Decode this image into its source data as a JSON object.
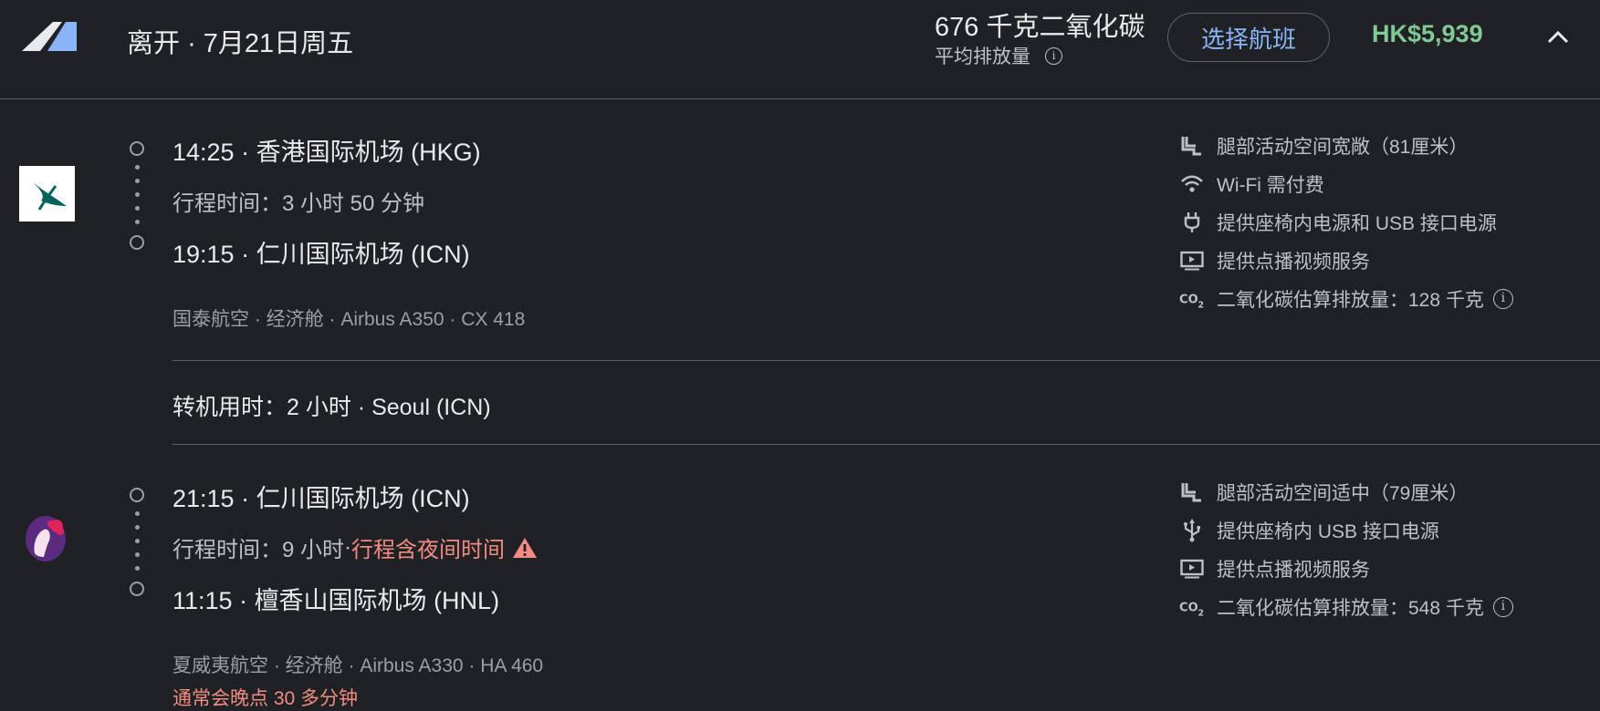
{
  "header": {
    "departure_label": "离开",
    "date": "7月21日周五",
    "co2_total": "676 千克二氧化碳",
    "co2_sub": "平均排放量",
    "select_button": "选择航班",
    "price": "HK$5,939",
    "logo_colors": [
      "#8ab4f8",
      "#e8eaed"
    ]
  },
  "segments": [
    {
      "airline_logo": "cathay-pacific-logo",
      "departure": {
        "time": "14:25",
        "airport": "香港国际机场 (HKG)"
      },
      "duration_label": "行程时间：",
      "duration": "3 小时 50 分钟",
      "arrival": {
        "time": "19:15",
        "airport": "仁川国际机场 (ICN)"
      },
      "details": "国泰航空 · 经济舱 · Airbus A350 · CX 418",
      "amenities": [
        {
          "icon": "legroom-icon",
          "text": "腿部活动空间宽敞（81厘米）"
        },
        {
          "icon": "wifi-icon",
          "text": "Wi-Fi 需付费"
        },
        {
          "icon": "power-plug-icon",
          "text": "提供座椅内电源和 USB 接口电源"
        },
        {
          "icon": "video-icon",
          "text": "提供点播视频服务"
        },
        {
          "icon": "co2-icon",
          "text": "二氧化碳估算排放量：128 千克"
        }
      ]
    },
    {
      "airline_logo": "hawaiian-airlines-logo",
      "departure": {
        "time": "21:15",
        "airport": "仁川国际机场 (ICN)"
      },
      "duration_label": "行程时间：",
      "duration": "9 小时",
      "overnight": "行程含夜间时间",
      "arrival": {
        "time": "11:15",
        "airport": "檀香山国际机场 (HNL)"
      },
      "details": "夏威夷航空 · 经济舱 · Airbus A330 · HA 460",
      "delay_note": "通常会晚点 30 多分钟",
      "amenities": [
        {
          "icon": "legroom-icon",
          "text": "腿部活动空间适中（79厘米）"
        },
        {
          "icon": "usb-icon",
          "text": "提供座椅内 USB 接口电源"
        },
        {
          "icon": "video-icon",
          "text": "提供点播视频服务"
        },
        {
          "icon": "co2-icon",
          "text": "二氧化碳估算排放量：548 千克"
        }
      ]
    }
  ],
  "layover": "转机用时：2 小时 · Seoul (ICN)",
  "colors": {
    "background": "#202124",
    "accent": "#8ab4f8",
    "price": "#81c995",
    "warning": "#f28b82"
  }
}
